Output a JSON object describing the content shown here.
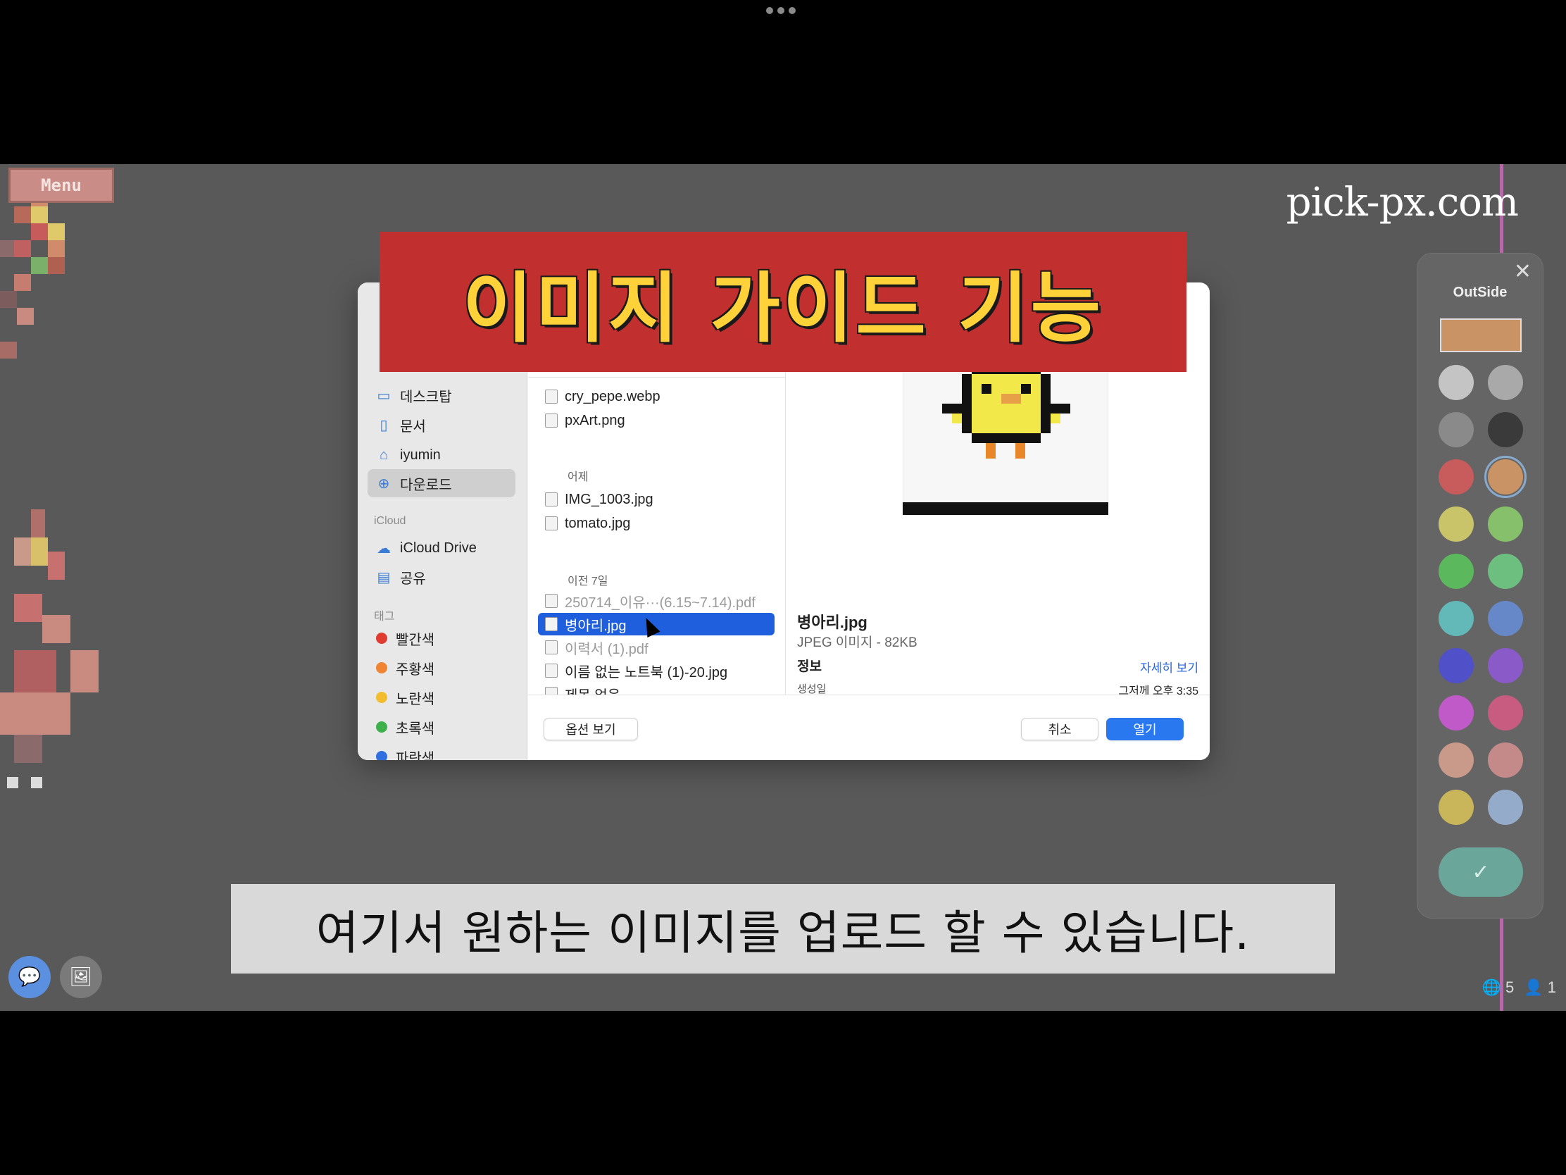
{
  "watermark": "pick-px.com",
  "menu_label": "Menu",
  "palette": {
    "title": "OutSide",
    "close_icon": "close-icon",
    "current_color": "#c99366",
    "swatches": [
      "#c4c4c4",
      "#a9a9a9",
      "#8a8a8a",
      "#3a3a3a",
      "#c85c5c",
      "#c99366",
      "#c9c46a",
      "#86c06a",
      "#5cb85c",
      "#6dbf80",
      "#63b8b8",
      "#6688c8",
      "#5050c8",
      "#8a5ac8",
      "#c05ac8",
      "#c85c80",
      "#c9998a",
      "#c48a8a",
      "#c9b55a",
      "#94acc9"
    ],
    "confirm_icon": "check-icon"
  },
  "stats": {
    "online": "5",
    "users": "1"
  },
  "dialog": {
    "sidebar": {
      "items": [
        {
          "label": "데스크탑",
          "icon": "desktop-icon"
        },
        {
          "label": "문서",
          "icon": "document-icon"
        },
        {
          "label": "iyumin",
          "icon": "home-icon"
        },
        {
          "label": "다운로드",
          "icon": "download-icon",
          "active": true
        }
      ],
      "icloud_header": "iCloud",
      "icloud_items": [
        {
          "label": "iCloud Drive",
          "icon": "cloud-icon"
        },
        {
          "label": "공유",
          "icon": "shared-folder-icon"
        }
      ],
      "tags_header": "태그",
      "tags": [
        {
          "label": "빨간색",
          "color": "#e03b30"
        },
        {
          "label": "주황색",
          "color": "#ef8432"
        },
        {
          "label": "노란색",
          "color": "#f1bd2e"
        },
        {
          "label": "초록색",
          "color": "#3db04b"
        },
        {
          "label": "파란색",
          "color": "#2f6fe0"
        }
      ]
    },
    "files": {
      "today": [
        "cry_pepe.webp",
        "pxArt.png"
      ],
      "yesterday_header": "어제",
      "yesterday": [
        "IMG_1003.jpg",
        "tomato.jpg"
      ],
      "week_header": "이전 7일",
      "week": [
        {
          "name": "250714_이유···(6.15~7.14).pdf",
          "dim": true
        },
        {
          "name": "병아리.jpg",
          "selected": true
        },
        {
          "name": "이력서 (1).pdf",
          "dim": true
        },
        {
          "name": "이름 없는 노트북 (1)-20.jpg"
        },
        {
          "name": "제목 없음 ..."
        }
      ]
    },
    "preview": {
      "name": "병아리.jpg",
      "kind": "JPEG 이미지 - 82KB",
      "info_label": "정보",
      "more_link": "자세히 보기",
      "created_label": "생성일",
      "created_value": "그저께 오후 3:35"
    },
    "buttons": {
      "options": "옵션 보기",
      "cancel": "취소",
      "open": "열기"
    }
  },
  "banner": "이미지 가이드 기능",
  "subtitle": "여기서 원하는 이미지를 업로드 할 수 있습니다."
}
